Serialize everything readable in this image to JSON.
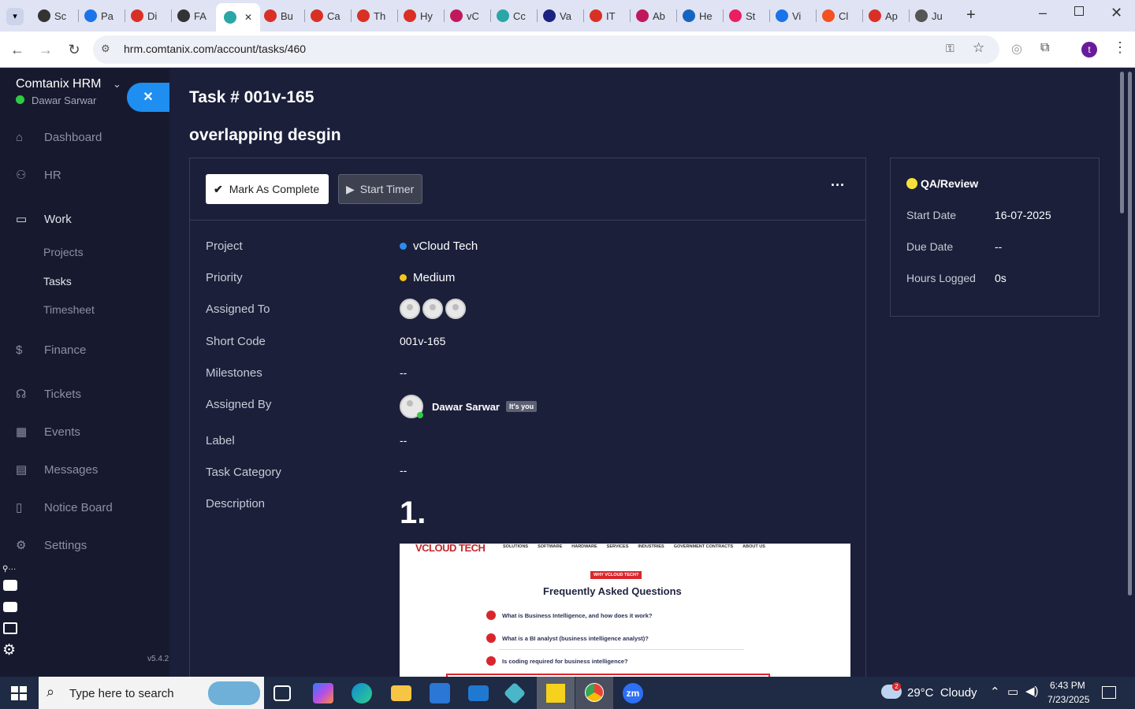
{
  "browser": {
    "tabs": [
      {
        "label": "Sc",
        "color": "#333"
      },
      {
        "label": "Pa",
        "color": "#1a73e8"
      },
      {
        "label": "Di",
        "color": "#d93025"
      },
      {
        "label": "FA",
        "color": "#333"
      },
      {
        "label": "",
        "color": "#2aa6a6",
        "active": true
      },
      {
        "label": "Bu",
        "color": "#d93025"
      },
      {
        "label": "Ca",
        "color": "#d93025"
      },
      {
        "label": "Th",
        "color": "#d93025"
      },
      {
        "label": "Hy",
        "color": "#d93025"
      },
      {
        "label": "vC",
        "color": "#c2185b"
      },
      {
        "label": "Cc",
        "color": "#2aa6a6"
      },
      {
        "label": "Va",
        "color": "#1a237e"
      },
      {
        "label": "IT",
        "color": "#d93025"
      },
      {
        "label": "Ab",
        "color": "#c2185b"
      },
      {
        "label": "He",
        "color": "#1565c0"
      },
      {
        "label": "St",
        "color": "#e91e63"
      },
      {
        "label": "Vi",
        "color": "#1a73e8"
      },
      {
        "label": "Cl",
        "color": "#f4511e"
      },
      {
        "label": "Ap",
        "color": "#d93025"
      },
      {
        "label": "Ju",
        "color": "#555"
      }
    ],
    "url": "hrm.comtanix.com/account/tasks/460",
    "profile_initial": "t"
  },
  "sidebar": {
    "company": "Comtanix HRM",
    "user": "Dawar Sarwar",
    "version": "v5.4.2",
    "items": [
      {
        "label": "Dashboard",
        "icon": "home-icon"
      },
      {
        "label": "HR",
        "icon": "users-icon"
      },
      {
        "label": "Work",
        "icon": "briefcase-icon"
      },
      {
        "label": "Finance",
        "icon": "dollar-icon"
      },
      {
        "label": "Tickets",
        "icon": "headset-icon"
      },
      {
        "label": "Events",
        "icon": "calendar-icon"
      },
      {
        "label": "Messages",
        "icon": "message-icon"
      },
      {
        "label": "Notice Board",
        "icon": "clipboard-icon"
      },
      {
        "label": "Settings",
        "icon": "gear-icon"
      }
    ],
    "work_sub": [
      "Projects",
      "Tasks",
      "Timesheet"
    ]
  },
  "task": {
    "heading": "Task # 001v-165",
    "title": "overlapping desgin",
    "mark_complete": "Mark As Complete",
    "start_timer": "Start Timer",
    "fields": {
      "project_label": "Project",
      "project": "vCloud Tech",
      "priority_label": "Priority",
      "priority": "Medium",
      "assigned_to_label": "Assigned To",
      "short_code_label": "Short Code",
      "short_code": "001v-165",
      "milestones_label": "Milestones",
      "milestones": "--",
      "assigned_by_label": "Assigned By",
      "assigned_by": "Dawar Sarwar",
      "its_you": "It's you",
      "label_label": "Label",
      "label": "--",
      "category_label": "Task Category",
      "category": "--",
      "description_label": "Description",
      "description_num": "1."
    },
    "status": "QA/Review",
    "start_date_label": "Start Date",
    "start_date": "16-07-2025",
    "due_date_label": "Due Date",
    "due_date": "--",
    "hours_label": "Hours Logged",
    "hours": "0s"
  },
  "preview": {
    "logo": "VCLOUD TECH",
    "menu": [
      "SOLUTIONS",
      "SOFTWARE",
      "HARDWARE",
      "SERVICES",
      "INDUSTRIES",
      "GOVERNMENT CONTRACTS",
      "ABOUT US"
    ],
    "badge": "WHY VCLOUD TECH?",
    "heading": "Frequently Asked Questions",
    "questions": [
      "What is Business Intelligence, and how does it work?",
      "What is a BI analyst (business intelligence analyst)?",
      "Is coding required for business intelligence?"
    ]
  },
  "taskbar": {
    "search": "Type here to search",
    "weather": "29°C  Cloudy",
    "weather_badge": "2",
    "time": "6:43 PM",
    "date": "7/23/2025"
  },
  "colors": {
    "accent": "#1f8ef1",
    "status": "#f5e13a",
    "project_dot": "#2d8cf0",
    "priority_dot": "#f5c518"
  }
}
